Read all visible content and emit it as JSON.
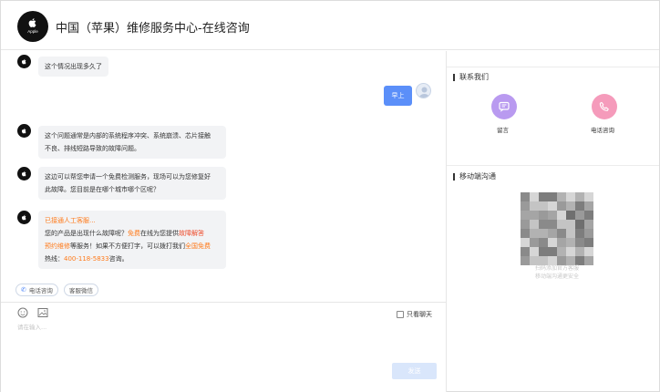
{
  "header": {
    "logo_text": "Apple",
    "title": "中国（苹果）维修服务中心-在线咨询"
  },
  "chat": {
    "messages": [
      {
        "side": "agent",
        "text": "这个情况出现多久了"
      },
      {
        "side": "user",
        "text": "早上"
      },
      {
        "side": "agent",
        "lines": [
          "这个问题通常是内部的系统程序冲突、系统崩溃、芯片接触",
          "不良、排线短路导致的故障问题。"
        ]
      },
      {
        "side": "agent",
        "lines": [
          "这边可以帮您申请一个免费检测服务，现场可以为您修复好",
          "此故障。您目前是在哪个城市哪个区呢？"
        ]
      },
      {
        "side": "agent",
        "transfer": "已接通人工客服...",
        "l1_a": "您的产品是出现什么故障呢？",
        "l1_free": "免费",
        "l1_b": "在线为您提供",
        "l1_solve": "故障解答",
        "l2_appt": "预约维修",
        "l2_b": "等服务！如果不方便打字，可以拨打我们",
        "l2_free": "全国免费",
        "l3_a": "热线：",
        "l3_phone": "400-118-5833",
        "l3_b": "咨询。"
      }
    ],
    "quick_buttons": [
      "电话咨询",
      "客服微信"
    ]
  },
  "input": {
    "placeholder": "请在输入...",
    "only_chat_label": "只看聊天",
    "send_label": "发送"
  },
  "right_panel": {
    "contact_title": "联系我们",
    "contact_items": [
      {
        "label": "留言",
        "color": "#b99af0"
      },
      {
        "label": "电话咨询",
        "color": "#f59bbb"
      }
    ],
    "mobile_title": "移动端沟通",
    "qr_caption_1": "扫码添加官方客服",
    "qr_caption_2": "移动端沟通更安全"
  },
  "colors": {
    "accent": "#5b8ff9",
    "highlight_orange": "#ff7a1a",
    "highlight_red": "#ee4b2b"
  }
}
